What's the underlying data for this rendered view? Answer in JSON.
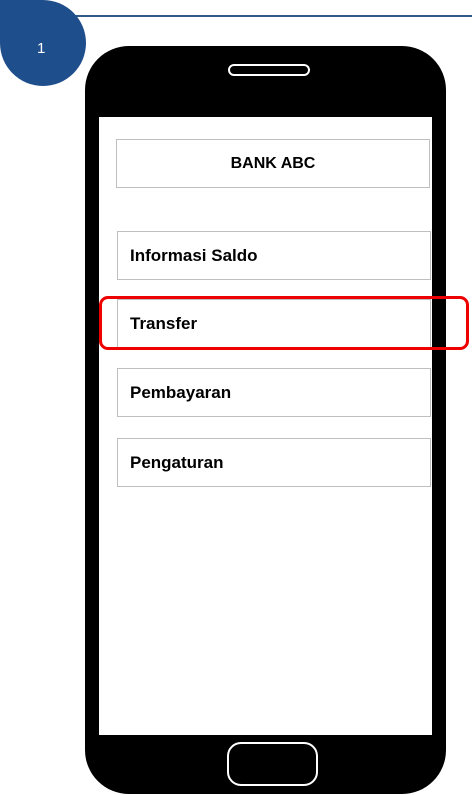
{
  "step": {
    "number": "1",
    "badge_color": "#1f4e8c",
    "line_color": "#2e5a8a"
  },
  "app": {
    "title": "BANK ABC"
  },
  "menu": {
    "items": [
      {
        "label": "Informasi Saldo"
      },
      {
        "label": "Transfer",
        "highlighted": true
      },
      {
        "label": "Pembayaran"
      },
      {
        "label": "Pengaturan"
      }
    ]
  },
  "colors": {
    "highlight": "#ee0000",
    "phone_body": "#000000",
    "box_border": "#bfbfbf"
  }
}
